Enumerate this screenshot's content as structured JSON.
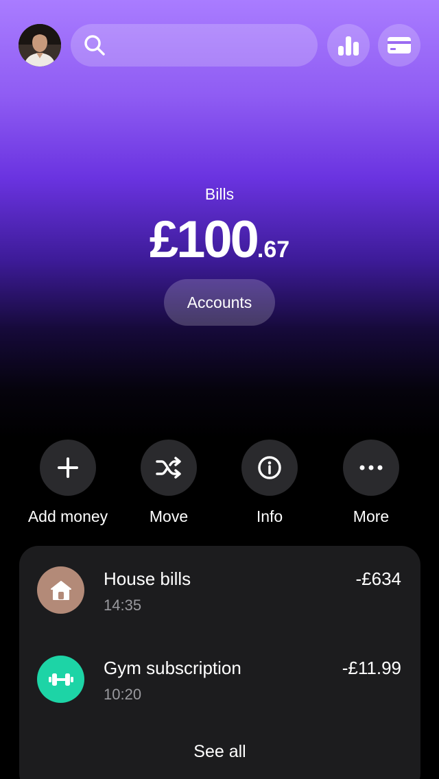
{
  "header": {
    "search_placeholder": "",
    "avatar_icon": "profile-photo",
    "buttons": [
      {
        "icon": "analytics-bar-chart-icon"
      },
      {
        "icon": "card-icon"
      }
    ]
  },
  "account": {
    "name": "Bills",
    "balance_main": "£100",
    "balance_cents": ".67",
    "accounts_label": "Accounts"
  },
  "actions": [
    {
      "label": "Add money",
      "icon": "plus-icon"
    },
    {
      "label": "Move",
      "icon": "shuffle-icon"
    },
    {
      "label": "Info",
      "icon": "info-icon"
    },
    {
      "label": "More",
      "icon": "more-dots-icon"
    }
  ],
  "transactions": [
    {
      "name": "House bills",
      "time": "14:35",
      "amount": "-£634",
      "icon": "house-icon",
      "color": "#b38a78"
    },
    {
      "name": "Gym subscription",
      "time": "10:20",
      "amount": "-£11.99",
      "icon": "dumbbell-icon",
      "color": "#1dd4a6"
    }
  ],
  "see_all_label": "See all"
}
